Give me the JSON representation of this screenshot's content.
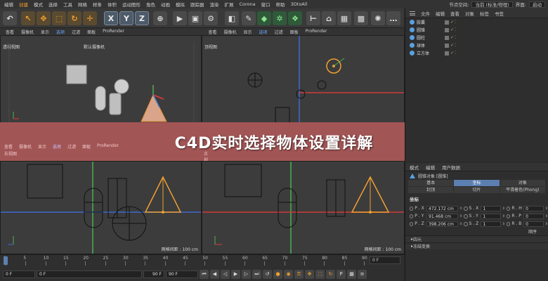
{
  "menubar": {
    "items": [
      "编辑",
      "创建",
      "模式",
      "选择",
      "工具",
      "网格",
      "样条",
      "体积",
      "运动图形",
      "角色",
      "动画",
      "模拟",
      "跟踪器",
      "渲染",
      "扩展",
      "Corona",
      "窗口",
      "帮助",
      "3DtoAll"
    ],
    "highlighted": "创建",
    "layout_label": "节点空间:",
    "layout_value": "当前 (标准/物理)",
    "ui_label": "界面:",
    "ui_value": "启动"
  },
  "toolbar": {
    "axis_buttons": [
      "X",
      "Y",
      "Z"
    ]
  },
  "object_manager": {
    "tabs": [
      "文件",
      "编辑",
      "查看",
      "对象",
      "标签",
      "书签"
    ],
    "objects": [
      {
        "name": "胶囊",
        "color": "#5aa0e0"
      },
      {
        "name": "圆锥",
        "color": "#5aa0e0"
      },
      {
        "name": "圆柱",
        "color": "#5aa0e0"
      },
      {
        "name": "球体",
        "color": "#5aa0e0"
      },
      {
        "name": "立方体",
        "color": "#5aa0e0"
      }
    ]
  },
  "viewport_menu": [
    "查看",
    "摄像机",
    "显示",
    "选项",
    "过滤",
    "面板",
    "ProRender"
  ],
  "viewports": {
    "perspective": {
      "title": "透视视图",
      "camera": "默认摄像机"
    },
    "top": {
      "title": "顶视图"
    },
    "right": {
      "title": "右视图",
      "grid_info": "网格间距 : 100 cm"
    },
    "front": {
      "title": "正视图",
      "grid_info": "网格间距 : 100 cm"
    }
  },
  "banner": {
    "title": "C4D实时选择物体设置详解"
  },
  "attributes": {
    "tabs": [
      "模式",
      "编辑",
      "用户数据"
    ],
    "object_label": "圆锥对象 [圆锥]",
    "prop_tabs": [
      "基本",
      "坐标",
      "对象",
      "封顶",
      "切片",
      "平滑着色(Phong)"
    ],
    "active_tab": "坐标",
    "section": "坐标",
    "rows": [
      {
        "p_label": "P . X",
        "p_value": "472.172 cm",
        "s_label": "S . X",
        "s_value": "1",
        "r_label": "R . H",
        "r_value": "0"
      },
      {
        "p_label": "P . Y",
        "p_value": "91.468 cm",
        "s_label": "S . Y",
        "s_value": "1",
        "r_label": "R . P",
        "r_value": "0"
      },
      {
        "p_label": "P . Z",
        "p_value": "398.206 cm",
        "s_label": "S . Z",
        "s_value": "1",
        "r_label": "R . B",
        "r_value": "0"
      }
    ],
    "order_label": "顺序",
    "folds": [
      "四元",
      "冻结变换"
    ]
  },
  "timeline": {
    "ticks": [
      "0",
      "5",
      "10",
      "15",
      "20",
      "25",
      "30",
      "35",
      "40",
      "45",
      "50",
      "55",
      "60",
      "65",
      "70",
      "75",
      "80",
      "85",
      "90"
    ],
    "start": "0 F",
    "min": "0 F",
    "max": "90 F",
    "end": "90 F",
    "current": "0 F"
  }
}
